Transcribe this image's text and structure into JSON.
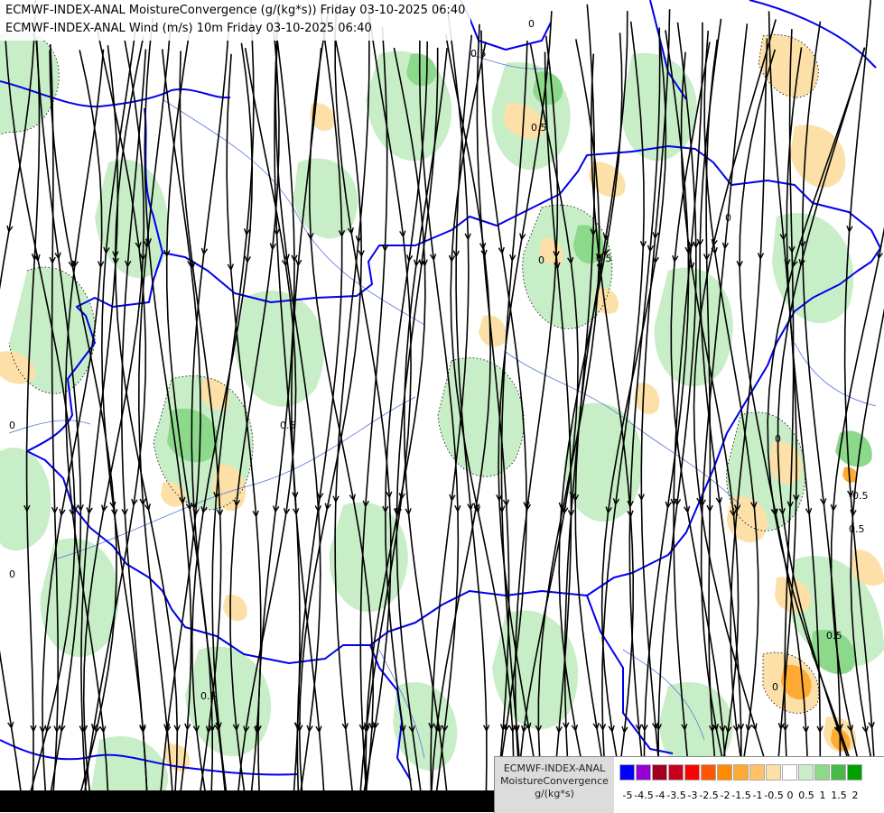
{
  "title_lines": [
    "ECMWF-INDEX-ANAL MoistureConvergence (g/(kg*s)) Friday 03-10-2025 06:40",
    "ECMWF-INDEX-ANAL Wind (m/s) 10m Friday 03-10-2025 06:40"
  ],
  "contour_labels": [
    "0.5",
    "0",
    "-0.5"
  ],
  "legend": {
    "line1": "ECMWF-INDEX-ANAL",
    "line2": "MoistureConvergence",
    "line3": "g/(kg*s)",
    "swatches": [
      {
        "color": "#0000ff",
        "value": "-5"
      },
      {
        "color": "#9400d3",
        "value": "-4.5"
      },
      {
        "color": "#a0001e",
        "value": "-4"
      },
      {
        "color": "#c8001e",
        "value": "-3.5"
      },
      {
        "color": "#ff0000",
        "value": "-3"
      },
      {
        "color": "#ff5500",
        "value": "-2.5"
      },
      {
        "color": "#ff8c00",
        "value": "-2"
      },
      {
        "color": "#ffaa33",
        "value": "-1.5"
      },
      {
        "color": "#ffc266",
        "value": "-1"
      },
      {
        "color": "#fce0a8",
        "value": "-0.5"
      },
      {
        "color": "#ffffff",
        "value": "0"
      },
      {
        "color": "#c8eec8",
        "value": "0.5"
      },
      {
        "color": "#8cd98c",
        "value": "1"
      },
      {
        "color": "#46b946",
        "value": "1.5"
      },
      {
        "color": "#00a000",
        "value": "2"
      }
    ]
  },
  "colors": {
    "border": "#0000ee",
    "river": "#5a78dc",
    "streamline": "#000000",
    "convergence_light": "#c8eec8",
    "convergence_mid": "#8cd98c",
    "divergence_light": "#fce0a8",
    "divergence_mid": "#ffaa33"
  }
}
